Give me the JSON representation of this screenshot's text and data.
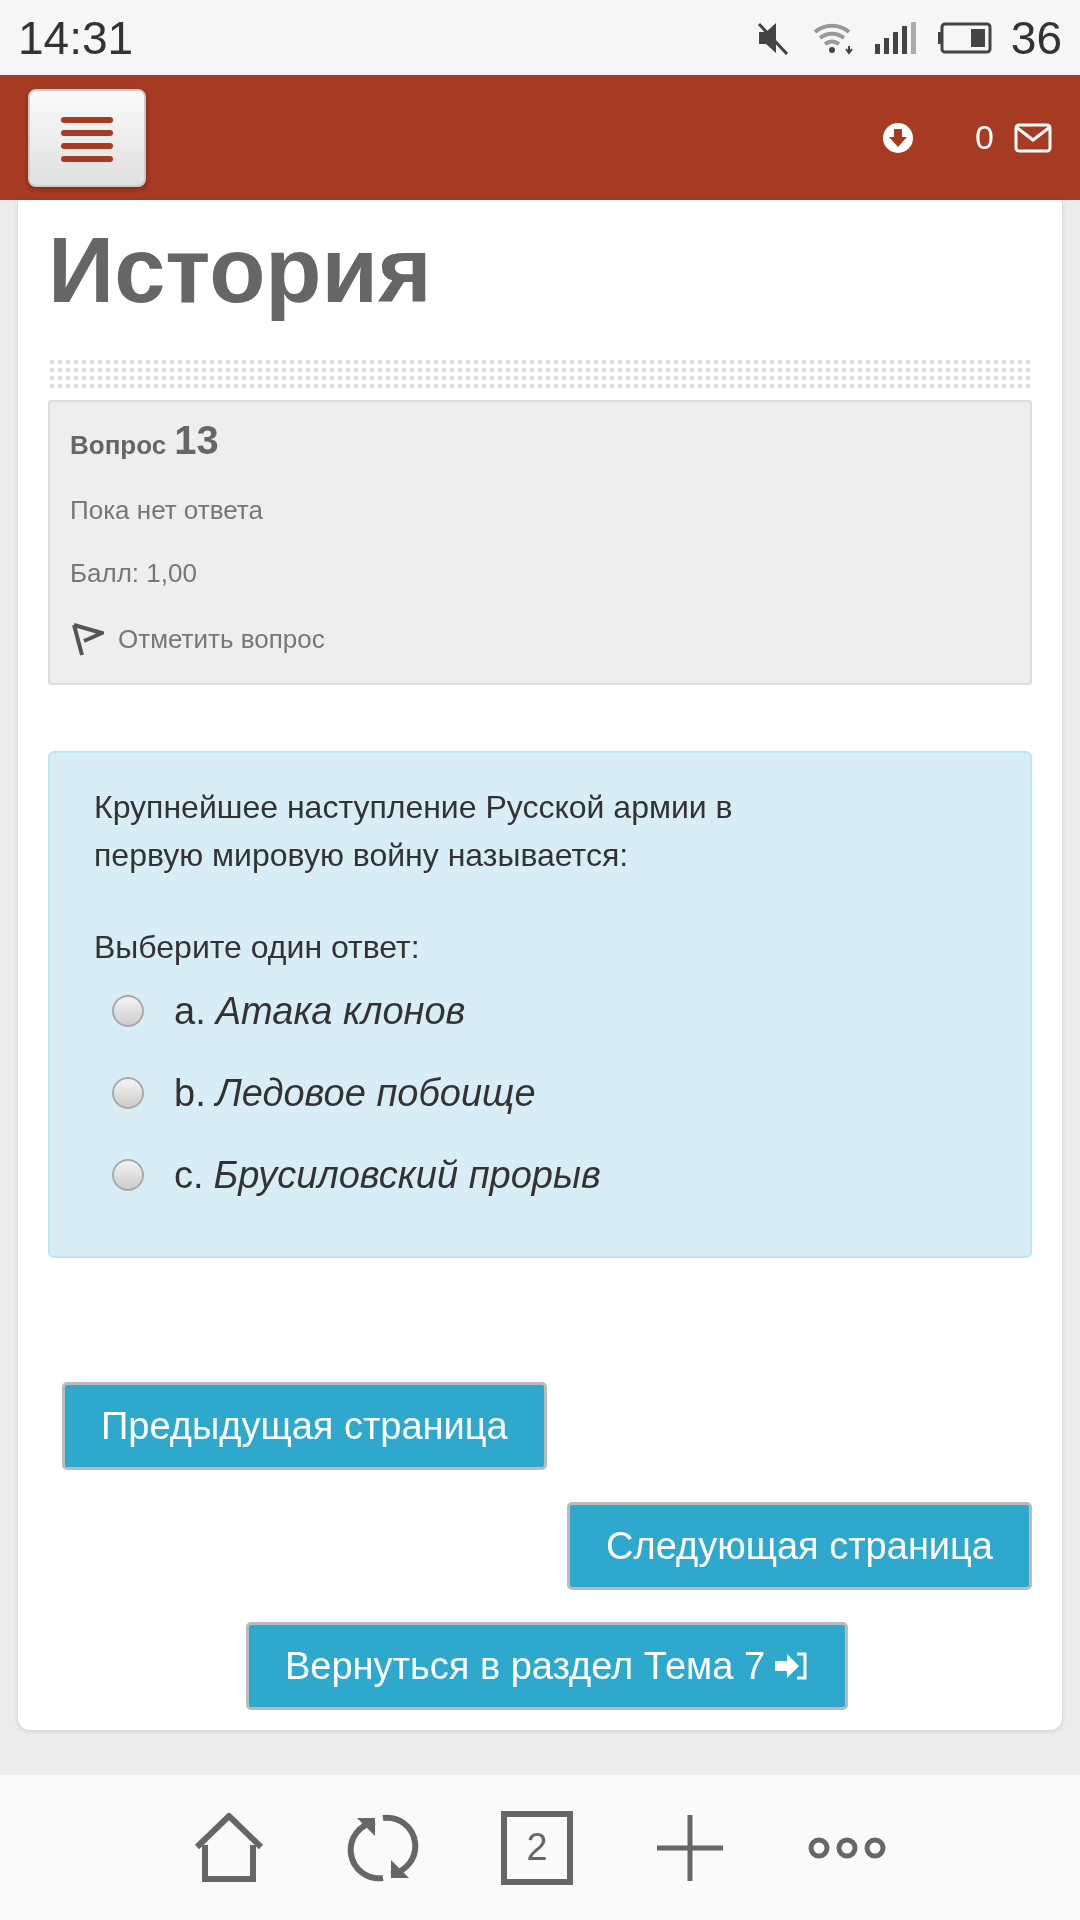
{
  "status_bar": {
    "time": "14:31",
    "battery": "36"
  },
  "header": {
    "messages_count": "0"
  },
  "page": {
    "title": "История"
  },
  "question_info": {
    "label": "Вопрос",
    "number": "13",
    "state": "Пока нет ответа",
    "grade": "Балл: 1,00",
    "flag_label": "Отметить вопрос"
  },
  "question": {
    "text": "Крупнейшее наступление Русской армии в первую мировую войну называется:",
    "prompt": "Выберите один ответ:",
    "options": [
      {
        "letter": "a.",
        "text": "Атака клонов",
        "selected": false
      },
      {
        "letter": "b.",
        "text": "Ледовое побоище",
        "selected": false
      },
      {
        "letter": "c.",
        "text": "Брусиловский прорыв",
        "selected": false
      }
    ]
  },
  "buttons": {
    "previous": "Предыдущая страница",
    "next": "Следующая страница",
    "back": "Вернуться в раздел Тема 7"
  },
  "bottom_bar": {
    "tabs_count": "2"
  }
}
